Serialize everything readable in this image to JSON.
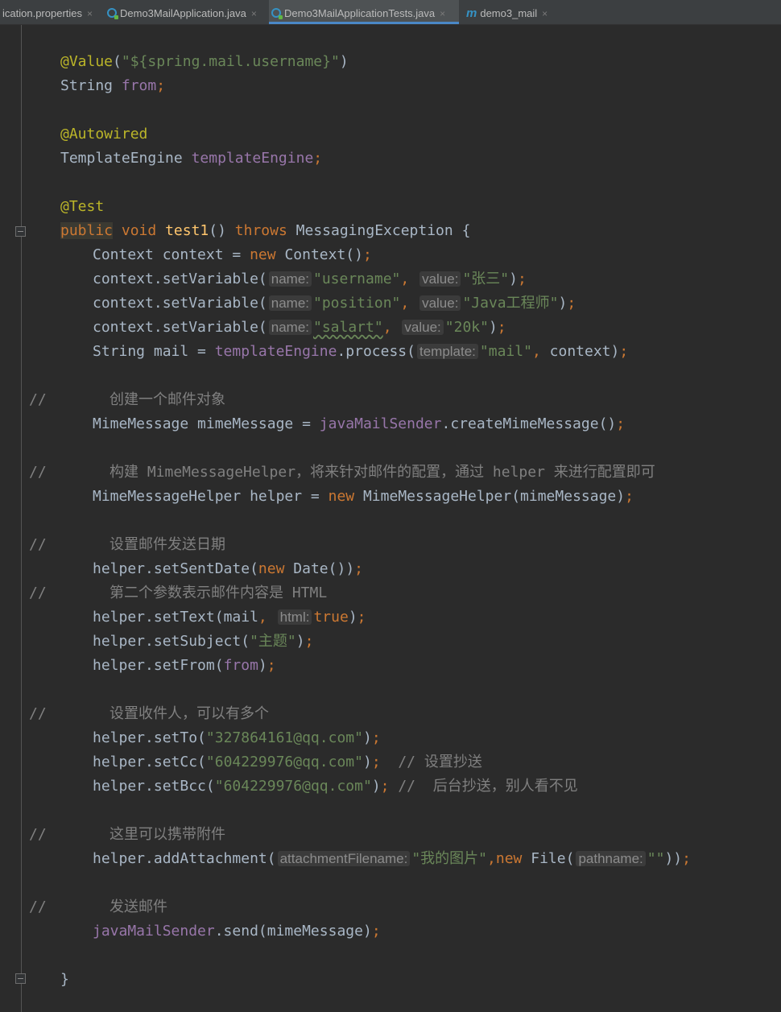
{
  "tabs": [
    {
      "label": "ication.properties",
      "icon": "properties-file-icon",
      "active": false
    },
    {
      "label": "Demo3MailApplication.java",
      "icon": "java-class-icon",
      "active": false
    },
    {
      "label": "Demo3MailApplicationTests.java",
      "icon": "java-class-icon",
      "active": true
    },
    {
      "label": "demo3_mail",
      "icon": "maven-m-icon",
      "active": false
    }
  ],
  "tab_close_glyph": "×",
  "maven_glyph": "m",
  "code": {
    "value_ann": "@Value",
    "value_arg": "\"${spring.mail.username}\"",
    "string_type": "String",
    "from_field": "from",
    "autowired_ann": "@Autowired",
    "template_engine_type": "TemplateEngine",
    "template_engine_field": "templateEngine",
    "test_ann": "@Test",
    "kw_public": "public",
    "kw_void": "void",
    "method_name": "test1",
    "kw_throws": "throws",
    "exception_type": "MessagingException",
    "context_decl": "Context context = ",
    "kw_new": "new",
    "context_ctor": "Context",
    "set_variable_call": "context.setVariable",
    "hint_name": "name:",
    "hint_value": "value:",
    "str_username": "\"username\"",
    "str_zhangsan": "\"张三\"",
    "str_position": "\"position\"",
    "str_java_engineer": "\"Java工程师\"",
    "str_salart": "\"salart\"",
    "str_20k": "\"20k\"",
    "mail_decl": "String mail = ",
    "process_call": ".process",
    "hint_template": "template:",
    "str_mail": "\"mail\"",
    "context_arg": "context",
    "comment_slash": "//",
    "comment_create": "创建一个邮件对象",
    "mime_decl": "MimeMessage mimeMessage = ",
    "java_mail_sender": "javaMailSender",
    "create_mime_call": ".createMimeMessage",
    "comment_helper": "构建 MimeMessageHelper，将来针对邮件的配置，通过 helper 来进行配置即可",
    "helper_decl": "MimeMessageHelper helper = ",
    "helper_ctor": "MimeMessageHelper",
    "mime_arg": "mimeMessage",
    "comment_date": "设置邮件发送日期",
    "set_sent_date": "helper.setSentDate",
    "date_ctor": "Date",
    "comment_html": "第二个参数表示邮件内容是 HTML",
    "set_text": "helper.setText",
    "mail_arg": "mail",
    "hint_html": "html:",
    "kw_true": "true",
    "set_subject": "helper.setSubject",
    "str_subject": "\"主题\"",
    "set_from": "helper.setFrom",
    "comment_recipients": "设置收件人，可以有多个",
    "set_to": "helper.setTo",
    "str_to": "\"327864161@qq.com\"",
    "set_cc": "helper.setCc",
    "str_cc": "\"604229976@qq.com\"",
    "comment_cc": "// 设置抄送",
    "set_bcc": "helper.setBcc",
    "str_bcc": "\"604229976@qq.com\"",
    "comment_bcc": "//  后台抄送，别人看不见",
    "comment_attach": "这里可以携带附件",
    "add_attachment": "helper.addAttachment",
    "hint_attachment_filename": "attachmentFilename:",
    "str_my_picture": "\"我的图片\"",
    "file_ctor": "File",
    "hint_pathname": "pathname:",
    "str_empty": "\"\"",
    "comment_send": "发送邮件",
    "send_call": ".send",
    "close_brace": "}",
    "open_brace": "{"
  }
}
